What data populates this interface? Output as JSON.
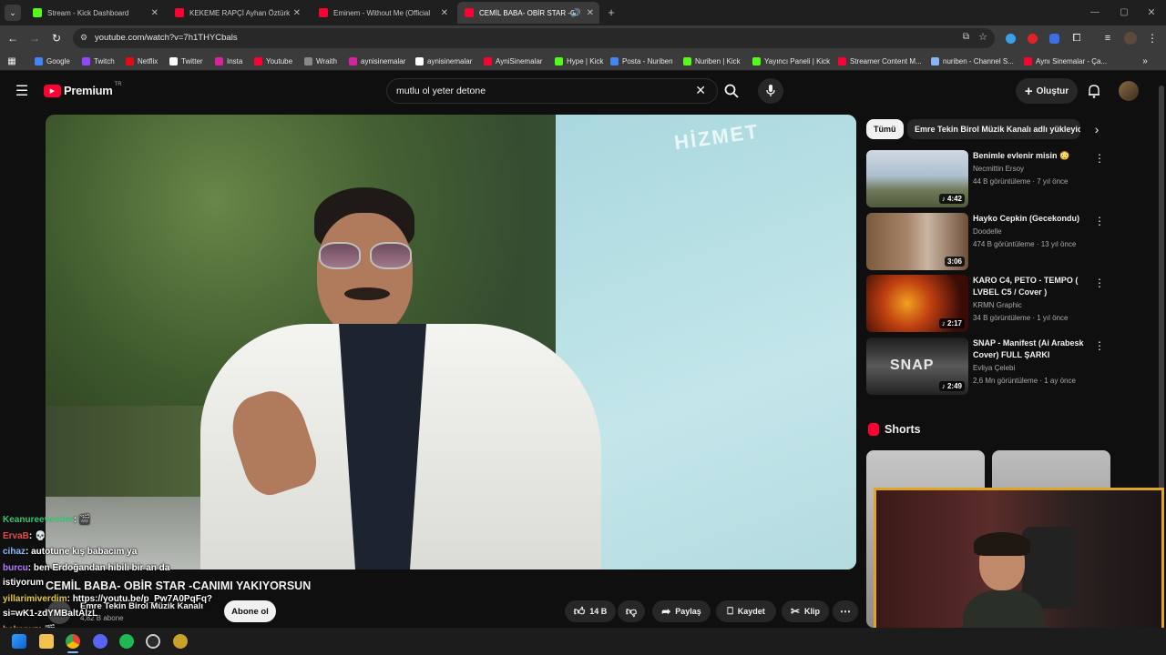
{
  "browser": {
    "tabs": [
      {
        "title": "Stream - Kick Dashboard",
        "color": "#53fc18"
      },
      {
        "title": "KEKEME RAPÇİ Ayhan Öztürk Y",
        "color": "#ff0033"
      },
      {
        "title": "Eminem - Without Me (Official",
        "color": "#ff0033"
      },
      {
        "title": "CEMİL BABA- OBİR STAR -C",
        "color": "#ff0033"
      }
    ],
    "url": "youtube.com/watch?v=7h1THYCbals",
    "bookmarks": [
      {
        "label": "Google",
        "color": "#4285f4"
      },
      {
        "label": "Twitch",
        "color": "#9146ff"
      },
      {
        "label": "Netflix",
        "color": "#e50914"
      },
      {
        "label": "Twitter",
        "color": "#ffffff"
      },
      {
        "label": "Insta",
        "color": "#d6249f"
      },
      {
        "label": "Youtube",
        "color": "#ff0033"
      },
      {
        "label": "Wraith",
        "color": "#888888"
      },
      {
        "label": "aynisinemalar",
        "color": "#d6249f"
      },
      {
        "label": "aynisinemalar",
        "color": "#ffffff"
      },
      {
        "label": "AyniSinemalar",
        "color": "#ff0033"
      },
      {
        "label": "Hype | Kick",
        "color": "#53fc18"
      },
      {
        "label": "Posta - Nuriben",
        "color": "#4285f4"
      },
      {
        "label": "Nuriben | Kick",
        "color": "#53fc18"
      },
      {
        "label": "Yayıncı Paneli | Kick",
        "color": "#53fc18"
      },
      {
        "label": "Streamer Content M...",
        "color": "#ff0033"
      },
      {
        "label": "nuriben - Channel S...",
        "color": "#8ab4f8"
      },
      {
        "label": "Aynı Sinemalar - Ça...",
        "color": "#ff0033"
      }
    ]
  },
  "youtube": {
    "logo_text": "Premium",
    "logo_badge": "TR",
    "search_value": "mutlu ol yeter detone",
    "create_label": "Oluştur",
    "chips": [
      "Tümü",
      "Emre Tekin Birol Müzik Kanalı adlı yükleyici"
    ],
    "recommendations": [
      {
        "title": "Benimle evlenir misin 😳",
        "channel": "Necmittin Ersoy",
        "meta": "44 B görüntüleme · 7 yıl önce",
        "duration": "4:42"
      },
      {
        "title": "Hayko Cepkin (Gecekondu)",
        "channel": "Doodelle",
        "meta": "474 B görüntüleme · 13 yıl önce",
        "duration": "3:06"
      },
      {
        "title": "KARO C4, PETO - TEMPO  ( LVBEL C5  / Cover )",
        "channel": "KRMN Graphic",
        "meta": "34 B görüntüleme · 1 yıl önce",
        "duration": "2:17"
      },
      {
        "title": "SNAP - Manifest (Ai Arabesk Cover) FULL ŞARKI",
        "channel": "Evliya Çelebi",
        "meta": "2,6 Mn görüntüleme · 1 ay önce",
        "duration": "2:49"
      }
    ],
    "shorts_label": "Shorts",
    "video": {
      "title": "CEMİL BABA- OBİR STAR -CANIMI YAKIYORSUN",
      "channel": "Emre Tekin Birol Müzik Kanalı",
      "subscribers": "4,82 B abone",
      "subscribe_label": "Abone ol",
      "likes": "14 B",
      "share_label": "Paylaş",
      "save_label": "Kaydet",
      "clip_label": "Klip",
      "sign_text": "HİZMET"
    }
  },
  "chat": [
    {
      "user": "Keanureevesder",
      "text": ": 🎬",
      "color": "#38c172"
    },
    {
      "user": "ErvaB",
      "text": ": 💀",
      "color": "#e84a4a"
    },
    {
      "user": "cihaz",
      "text": ": autotune kış babacım ya",
      "color": "#8ab4f8"
    },
    {
      "user": "burcu",
      "text": ": ben Erdoğandan hibili bir an da",
      "color": "#b57bff"
    },
    {
      "user": "",
      "text": "istiyorum",
      "color": "#ffffff"
    },
    {
      "user": "yillarimiverdim",
      "text": ": https://youtu.be/p_Pw7A0PqFq?",
      "color": "#e0c341"
    },
    {
      "user": "",
      "text": "si=wK1-zdYMBaltAlzL",
      "color": "#ffffff"
    },
    {
      "user": "hakanyz",
      "text": ": 🎬",
      "color": "#e0a526"
    }
  ]
}
